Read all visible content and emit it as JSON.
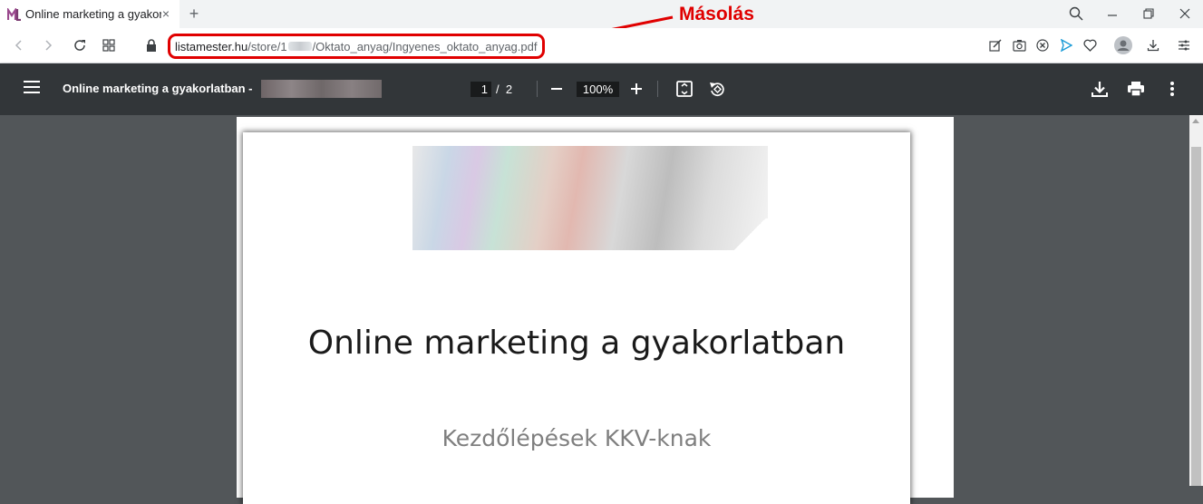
{
  "browser": {
    "tab": {
      "title": "Online marketing a gyakorlatban"
    },
    "url": {
      "host": "listamester.hu",
      "path_start": "/store/1",
      "path_end": "/Oktato_anyag/Ingyenes_oktato_anyag.pdf"
    }
  },
  "annotation": {
    "label": "Másolás",
    "color": "#e00000"
  },
  "pdf_viewer": {
    "title": "Online marketing a gyakorlatban -",
    "current_page": "1",
    "page_separator": "/",
    "total_pages": "2",
    "zoom": "100%",
    "document": {
      "title": "Online marketing a gyakorlatban",
      "subtitle": "Kezdőlépések KKV-knak"
    }
  },
  "icons": [
    "brand-logo-icon",
    "close-icon",
    "plus-icon",
    "search-icon",
    "minimize-icon",
    "restore-icon",
    "close-window-icon",
    "back-arrow-icon",
    "forward-arrow-icon",
    "reload-icon",
    "grid-icon",
    "lock-icon",
    "edit-icon",
    "camera-icon",
    "blocker-icon",
    "send-icon",
    "heart-icon",
    "avatar-icon",
    "download-icon",
    "menu-icon",
    "hamburger-icon",
    "minus-icon",
    "fit-page-icon",
    "rotate-icon",
    "print-icon",
    "more-vert-icon"
  ]
}
